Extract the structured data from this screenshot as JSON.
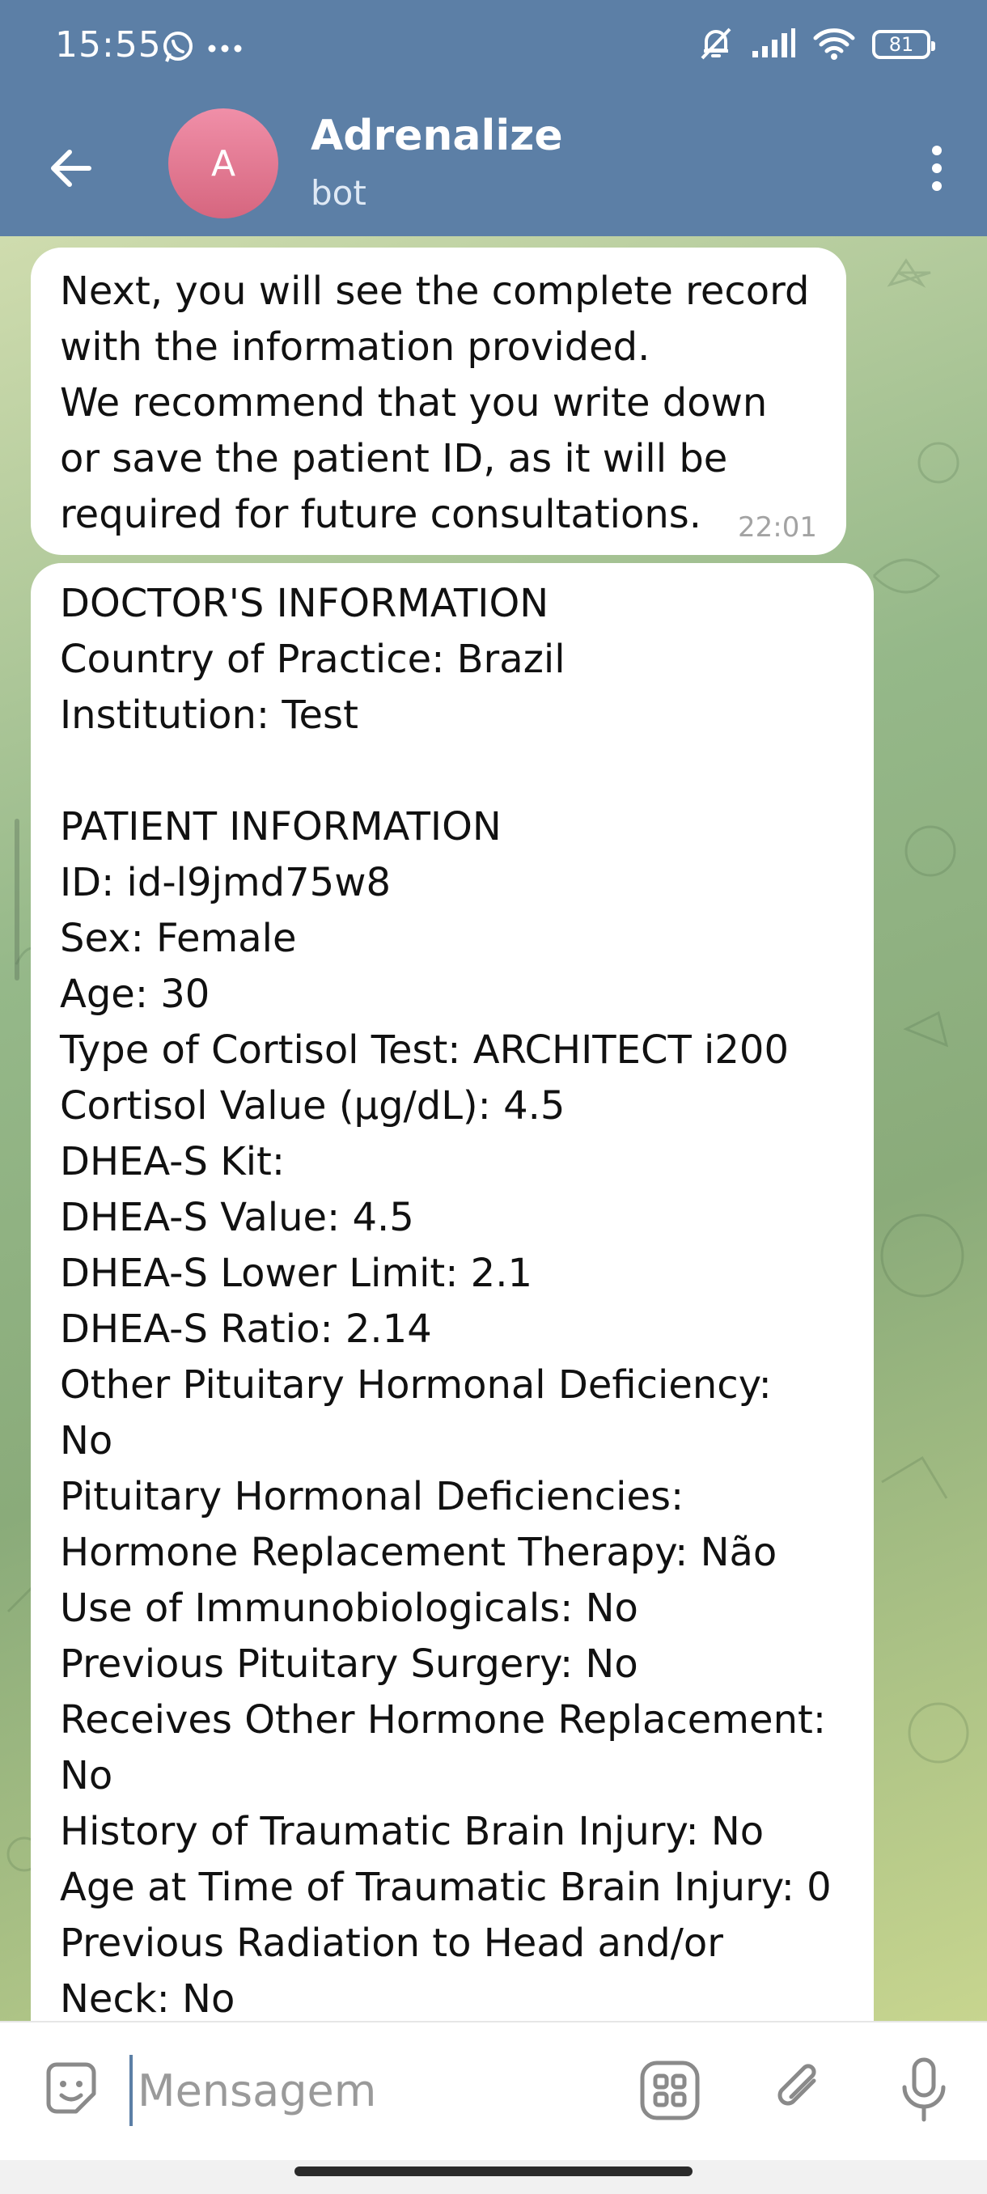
{
  "status_bar": {
    "time": "15:55",
    "left_icons": [
      "whatsapp-icon",
      "more-notifications-icon"
    ],
    "right_icons": [
      "mute-bell-icon",
      "signal-icon",
      "wifi-icon",
      "battery-icon"
    ],
    "battery": "81"
  },
  "header": {
    "avatar_letter": "A",
    "title": "Adrenalize",
    "subtitle": "bot",
    "colors": {
      "header_bg": "#5c7fa6",
      "avatar": "#e07a93"
    }
  },
  "messages": [
    {
      "lines": [
        "Next, you will see the complete record",
        "with the information provided.",
        "We recommend that you write down",
        "or save the patient ID, as it will be",
        "required for future consultations."
      ],
      "time": "22:01"
    },
    {
      "lines": [
        "DOCTOR'S INFORMATION",
        "Country of Practice: Brazil",
        "Institution: Test",
        "",
        "PATIENT INFORMATION",
        "ID: id-l9jmd75w8",
        "Sex: Female",
        "Age: 30",
        "Type of Cortisol Test: ARCHITECT i200",
        "Cortisol Value (µg/dL): 4.5",
        "DHEA-S Kit:",
        "DHEA-S Value: 4.5",
        "DHEA-S Lower Limit: 2.1",
        "DHEA-S Ratio: 2.14",
        "Other Pituitary Hormonal Deficiency:",
        "No",
        "Pituitary Hormonal Deficiencies:",
        "Hormone Replacement Therapy: Não",
        "Use of Immunobiologicals: No",
        "Previous Pituitary Surgery: No",
        "Receives Other Hormone Replacement:",
        "No",
        "History of Traumatic Brain Injury: No",
        "Age at Time of Traumatic Brain Injury: 0",
        "Previous Radiation to Head and/or",
        "Neck: No"
      ]
    }
  ],
  "input": {
    "placeholder": "Mensagem",
    "value": ""
  },
  "input_icons": [
    "emoji-icon",
    "apps-icon",
    "paperclip-icon",
    "microphone-icon"
  ]
}
